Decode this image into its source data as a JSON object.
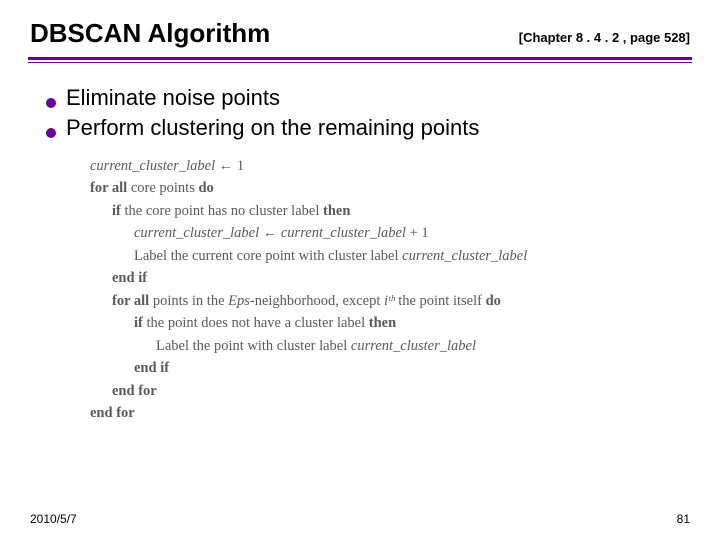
{
  "title": "DBSCAN Algorithm",
  "chapter_ref": "[Chapter 8 . 4 . 2 , page 528]",
  "bullets": [
    "Eliminate noise points",
    "Perform clustering on the remaining points"
  ],
  "pseudocode": {
    "line1_var": "current_cluster_label",
    "line1_arrow": " ← 1",
    "line2_kw1": "for all",
    "line2_txt": " core points ",
    "line2_kw2": "do",
    "line3_kw1": "if",
    "line3_txt": " the core point has no cluster label ",
    "line3_kw2": "then",
    "line4_var1": "current_cluster_label",
    "line4_mid": " ← ",
    "line4_var2": "current_cluster_label",
    "line4_end": " + 1",
    "line5_txt": "Label the current core point with cluster label ",
    "line5_var": "current_cluster_label",
    "line6_kw": "end if",
    "line7_kw1": "for all",
    "line7_txt1": " points in the ",
    "line7_var1": "Eps",
    "line7_txt2": "-neighborhood, except ",
    "line7_var2": "iᵗʰ",
    "line7_txt3": " the point itself ",
    "line7_kw2": "do",
    "line8_kw1": "if",
    "line8_txt": " the point does not have a cluster label ",
    "line8_kw2": "then",
    "line9_txt": "Label the point with cluster label ",
    "line9_var": "current_cluster_label",
    "line10_kw": "end if",
    "line11_kw": "end for",
    "line12_kw": "end for"
  },
  "footer": {
    "date": "2010/5/7",
    "page_number": "81"
  }
}
